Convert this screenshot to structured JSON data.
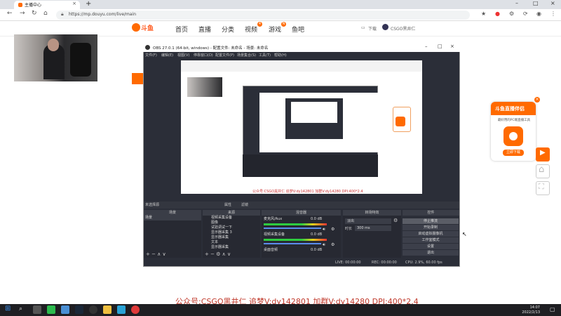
{
  "browser": {
    "tab_title": "主播中心",
    "url": "https://mp.douyu.com/live/main",
    "toolbar_icons": [
      "back-icon",
      "forward-icon",
      "reload-icon",
      "home-icon",
      "star-icon",
      "extension-icon",
      "profile-icon",
      "menu-icon"
    ]
  },
  "site": {
    "logo_text": "斗鱼",
    "nav": [
      "首页",
      "直播",
      "分类",
      "视频",
      "游戏",
      "鱼吧"
    ],
    "nav_badges": {
      "视频": "4",
      "游戏": "N"
    },
    "download_label": "下载",
    "user_label": "CSGO黑井仁"
  },
  "obs": {
    "title": "OBS 27.0.1 (64-bit, windows) - 配置文件: 未命名 - 场景: 未命名",
    "menu": [
      "文件(F)",
      "编辑(E)",
      "视图(V)",
      "停靠窗口(D)",
      "配置文件(P)",
      "场景集合(S)",
      "工具(T)",
      "帮助(H)"
    ],
    "dock_bar_label": "未选择源",
    "dock_bar_buttons": [
      "属性",
      "滤镜"
    ],
    "docks": {
      "scenes": {
        "title": "场景",
        "items": [
          "场景"
        ]
      },
      "sources": {
        "title": "来源",
        "items": [
          "视频采集设备",
          "图像",
          "试验调试一下",
          "显示器采集 3",
          "显示器采集",
          "文本",
          "显示器采集"
        ]
      },
      "mixer": {
        "title": "混音器",
        "channels": [
          {
            "name": "麦克风/Aux",
            "value": "0.0 dB"
          },
          {
            "name": "视频采集设备",
            "value": "0.0 dB"
          },
          {
            "name": "桌面音频",
            "value": "0.0 dB"
          }
        ]
      },
      "transitions": {
        "title": "转场特效",
        "type": "淡出",
        "duration_label": "时长",
        "duration": "300 ms"
      },
      "controls": {
        "title": "控件",
        "buttons": [
          "停止推流",
          "开始录制",
          "启动虚拟摄像机",
          "工作室模式",
          "设置",
          "退出"
        ]
      }
    },
    "status": {
      "live": "LIVE: 00:00:00",
      "rec": "REC: 00:00:00",
      "cpu": "CPU: 2.9%, 60.00 fps"
    }
  },
  "preview_caption": "公众号:CSGO黑井仁 追梦V:dy142801 加群V:dy14280 DPI:400*2.4",
  "promo": {
    "title": "斗鱼直播伴侣",
    "subtitle": "最好用的PC端直播工具",
    "button": "立即下载"
  },
  "overlay_text": "公众号:CSGO黑井仁 追梦V:dy142801 加群V:dy14280 DPI:400*2.4",
  "taskbar": {
    "time": "14:07",
    "date": "2022/2/13"
  },
  "colors": {
    "brand": "#ff6a00",
    "obs_bg": "#2b2e38",
    "overlay": "#c0392b"
  }
}
